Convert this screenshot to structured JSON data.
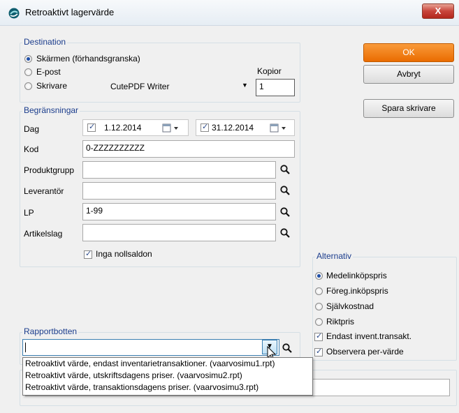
{
  "window": {
    "title": "Retroaktivt lagervärde",
    "close_label": "X"
  },
  "destination": {
    "legend": "Destination",
    "options": [
      "Skärmen (förhandsgranska)",
      "E-post",
      "Skrivare"
    ],
    "selected": 0,
    "copies_label": "Kopior",
    "printer_value": "CutePDF Writer",
    "copies_value": "1"
  },
  "limits": {
    "legend": "Begränsningar",
    "day_label": "Dag",
    "date_from": "1.12.2014",
    "date_to": "31.12.2014",
    "date_from_checked": true,
    "date_to_checked": true,
    "code_label": "Kod",
    "code_value": "0-ZZZZZZZZZZ",
    "productgroup_label": "Produktgrupp",
    "productgroup_value": "",
    "supplier_label": "Leverantör",
    "supplier_value": "",
    "lp_label": "LP",
    "lp_value": "1-99",
    "articletype_label": "Artikelslag",
    "articletype_value": "",
    "no_zero_label": "Inga nollsaldon",
    "no_zero_checked": true
  },
  "buttons": {
    "ok": "OK",
    "cancel": "Avbryt",
    "save_printer": "Spara skrivare"
  },
  "alternatives": {
    "legend": "Alternativ",
    "radios": [
      "Medelinköpspris",
      "Föreg.inköpspris",
      "Självkostnad",
      "Riktpris"
    ],
    "selected": 0,
    "checks": [
      {
        "label": "Endast invent.transakt.",
        "checked": true
      },
      {
        "label": "Observera per-värde",
        "checked": true
      }
    ]
  },
  "report_base": {
    "legend": "Rapportbotten",
    "value": "",
    "dropdown_items": [
      "Retroaktivt värde, endast inventarietransaktioner. (vaarvosimu1.rpt)",
      "Retroaktivt värde, utskriftsdagens priser. (vaarvosimu2.rpt)",
      "Retroaktivt värde, transaktionsdagens priser. (vaarvosimu3.rpt)"
    ]
  },
  "colors": {
    "accent": "#ea6c00",
    "legend_text": "#1a3c8c"
  },
  "icons": [
    "app-icon",
    "search-icon",
    "calendar-icon",
    "chevron-down-icon",
    "mouse-cursor-icon"
  ]
}
